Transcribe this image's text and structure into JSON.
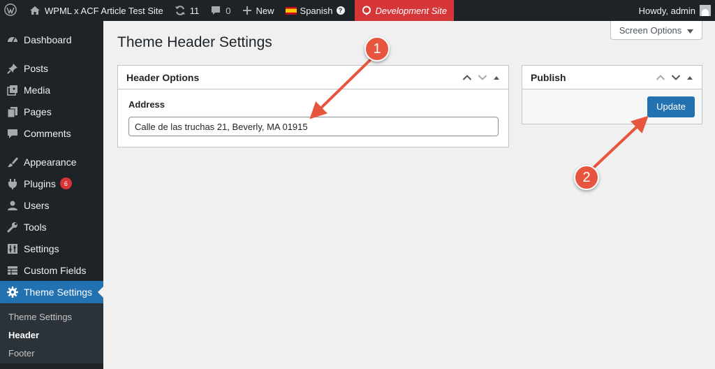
{
  "colors": {
    "admin_bar_bg": "#1d2327",
    "accent": "#2271b1",
    "dev_site_bg": "#d63638",
    "badge_bg": "#d63638",
    "annotation": "#e8553f"
  },
  "admin_bar": {
    "wp_logo_icon": "wordpress-logo-icon",
    "site_name": "WPML x ACF Article Test Site",
    "updates_count": "11",
    "comments_count": "0",
    "new_label": "New",
    "language": "Spanish",
    "dev_site_label": "Development Site",
    "howdy": "Howdy, admin"
  },
  "screen_options": {
    "label": "Screen Options"
  },
  "sidebar": {
    "items": [
      {
        "label": "Dashboard",
        "icon": "dashboard-icon"
      },
      {
        "label": "Posts",
        "icon": "pin-icon"
      },
      {
        "label": "Media",
        "icon": "media-icon"
      },
      {
        "label": "Pages",
        "icon": "pages-icon"
      },
      {
        "label": "Comments",
        "icon": "comments-icon"
      },
      {
        "label": "Appearance",
        "icon": "brush-icon"
      },
      {
        "label": "Plugins",
        "icon": "plugin-icon",
        "badge": "6"
      },
      {
        "label": "Users",
        "icon": "users-icon"
      },
      {
        "label": "Tools",
        "icon": "wrench-icon"
      },
      {
        "label": "Settings",
        "icon": "settings-sliders-icon"
      },
      {
        "label": "Custom Fields",
        "icon": "table-icon"
      },
      {
        "label": "Theme Settings",
        "icon": "gear-icon"
      }
    ],
    "submenu": [
      "Theme Settings",
      "Header",
      "Footer"
    ]
  },
  "page": {
    "title": "Theme Header Settings"
  },
  "header_options": {
    "title": "Header Options",
    "address_label": "Address",
    "address_value": "Calle de las truchas 21, Beverly, MA 01915"
  },
  "publish": {
    "title": "Publish",
    "update_label": "Update"
  },
  "annotations": {
    "step1": "1",
    "step2": "2"
  }
}
